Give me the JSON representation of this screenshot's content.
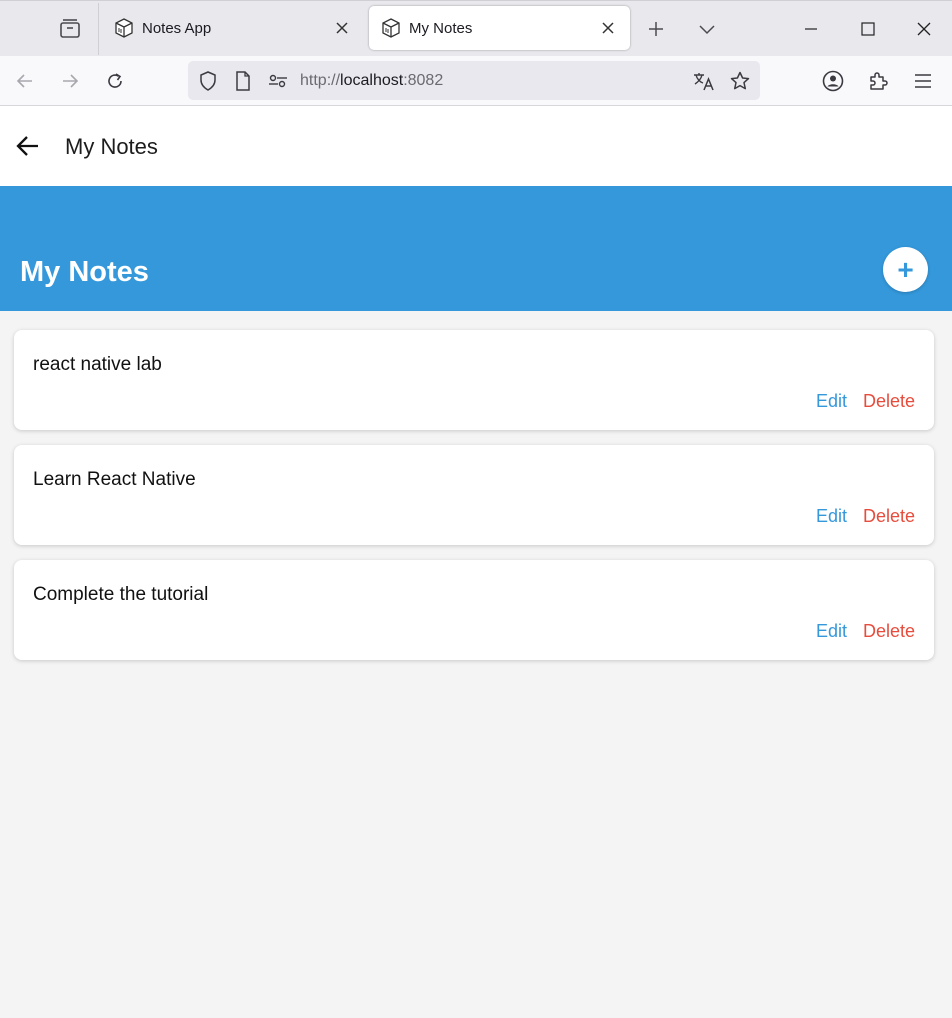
{
  "browser": {
    "tabs": [
      {
        "title": "Notes App",
        "active": false
      },
      {
        "title": "My Notes",
        "active": true
      }
    ],
    "url": {
      "scheme": "http://",
      "host": "localhost",
      "port": ":8082"
    }
  },
  "app": {
    "header_title": "My Notes",
    "hero_title": "My Notes",
    "add_label": "+"
  },
  "notes": [
    {
      "text": "react native lab",
      "edit_label": "Edit",
      "delete_label": "Delete"
    },
    {
      "text": "Learn React Native",
      "edit_label": "Edit",
      "delete_label": "Delete"
    },
    {
      "text": "Complete the tutorial",
      "edit_label": "Edit",
      "delete_label": "Delete"
    }
  ],
  "colors": {
    "accent": "#3498db",
    "delete": "#e74c3c",
    "background": "#f4f4f4"
  }
}
